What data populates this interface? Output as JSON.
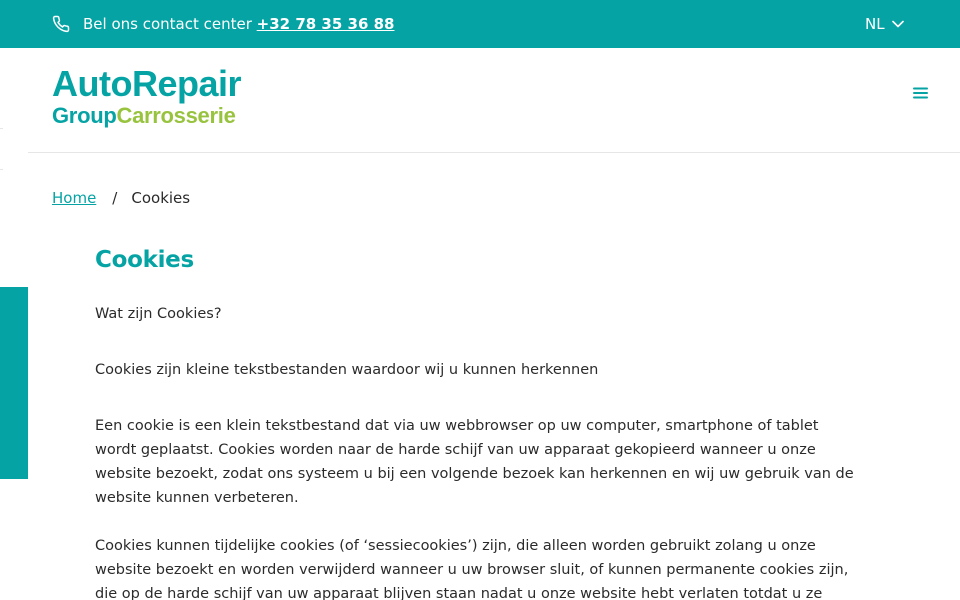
{
  "topbar": {
    "contact_text": "Bel ons contact center",
    "phone_number": "+32 78 35 36 88",
    "language": "NL",
    "color": "#05a3a4"
  },
  "header": {
    "logo_line1": "AutoRepair",
    "logo_group": "Group",
    "logo_carrosserie": "Carrosserie",
    "menu_icon": "hamburger-icon"
  },
  "breadcrumb": {
    "home": "Home",
    "separator": "/",
    "current": "Cookies"
  },
  "content": {
    "title": "Cookies",
    "p1": "Wat zijn Cookies?",
    "p2": "Cookies zijn kleine tekstbestanden waardoor wij u kunnen herkennen",
    "p3": "Een cookie is een klein tekstbestand dat via uw webbrowser op uw computer, smartphone of tablet wordt geplaatst. Cookies worden naar de harde schijf van uw apparaat gekopieerd wanneer u onze website bezoekt, zodat ons systeem u bij een volgende bezoek kan herkennen en wij uw gebruik van de website kunnen verbeteren.",
    "p4": "Cookies kunnen tijdelijke cookies (of ‘sessiecookies’) zijn, die alleen worden gebruikt zolang u onze website bezoekt en worden verwijderd wanneer u uw browser sluit, of kunnen permanente cookies zijn, die op de harde schijf van uw apparaat blijven staan nadat u onze website hebt verlaten totdat u ze handmatig verwijdert of uw"
  },
  "colors": {
    "teal": "#05a3a4",
    "green": "#98c33e"
  }
}
